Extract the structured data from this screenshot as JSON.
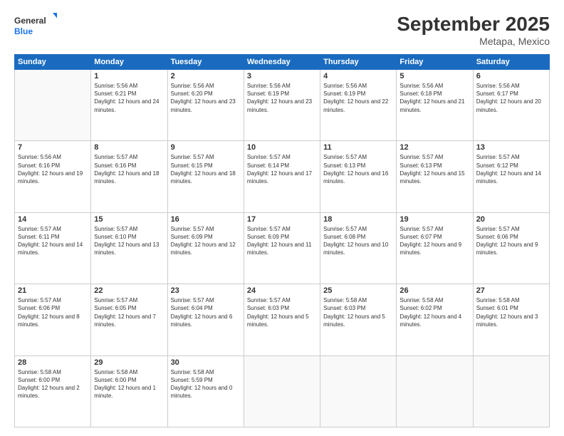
{
  "header": {
    "logo": {
      "general": "General",
      "blue": "Blue"
    },
    "title": "September 2025",
    "subtitle": "Metapa, Mexico"
  },
  "weekdays": [
    "Sunday",
    "Monday",
    "Tuesday",
    "Wednesday",
    "Thursday",
    "Friday",
    "Saturday"
  ],
  "weeks": [
    [
      {
        "day": null
      },
      {
        "day": 1,
        "sunrise": "5:56 AM",
        "sunset": "6:21 PM",
        "daylight": "12 hours and 24 minutes."
      },
      {
        "day": 2,
        "sunrise": "5:56 AM",
        "sunset": "6:20 PM",
        "daylight": "12 hours and 23 minutes."
      },
      {
        "day": 3,
        "sunrise": "5:56 AM",
        "sunset": "6:19 PM",
        "daylight": "12 hours and 23 minutes."
      },
      {
        "day": 4,
        "sunrise": "5:56 AM",
        "sunset": "6:19 PM",
        "daylight": "12 hours and 22 minutes."
      },
      {
        "day": 5,
        "sunrise": "5:56 AM",
        "sunset": "6:18 PM",
        "daylight": "12 hours and 21 minutes."
      },
      {
        "day": 6,
        "sunrise": "5:56 AM",
        "sunset": "6:17 PM",
        "daylight": "12 hours and 20 minutes."
      }
    ],
    [
      {
        "day": 7,
        "sunrise": "5:56 AM",
        "sunset": "6:16 PM",
        "daylight": "12 hours and 19 minutes."
      },
      {
        "day": 8,
        "sunrise": "5:57 AM",
        "sunset": "6:16 PM",
        "daylight": "12 hours and 18 minutes."
      },
      {
        "day": 9,
        "sunrise": "5:57 AM",
        "sunset": "6:15 PM",
        "daylight": "12 hours and 18 minutes."
      },
      {
        "day": 10,
        "sunrise": "5:57 AM",
        "sunset": "6:14 PM",
        "daylight": "12 hours and 17 minutes."
      },
      {
        "day": 11,
        "sunrise": "5:57 AM",
        "sunset": "6:13 PM",
        "daylight": "12 hours and 16 minutes."
      },
      {
        "day": 12,
        "sunrise": "5:57 AM",
        "sunset": "6:13 PM",
        "daylight": "12 hours and 15 minutes."
      },
      {
        "day": 13,
        "sunrise": "5:57 AM",
        "sunset": "6:12 PM",
        "daylight": "12 hours and 14 minutes."
      }
    ],
    [
      {
        "day": 14,
        "sunrise": "5:57 AM",
        "sunset": "6:11 PM",
        "daylight": "12 hours and 14 minutes."
      },
      {
        "day": 15,
        "sunrise": "5:57 AM",
        "sunset": "6:10 PM",
        "daylight": "12 hours and 13 minutes."
      },
      {
        "day": 16,
        "sunrise": "5:57 AM",
        "sunset": "6:09 PM",
        "daylight": "12 hours and 12 minutes."
      },
      {
        "day": 17,
        "sunrise": "5:57 AM",
        "sunset": "6:09 PM",
        "daylight": "12 hours and 11 minutes."
      },
      {
        "day": 18,
        "sunrise": "5:57 AM",
        "sunset": "6:08 PM",
        "daylight": "12 hours and 10 minutes."
      },
      {
        "day": 19,
        "sunrise": "5:57 AM",
        "sunset": "6:07 PM",
        "daylight": "12 hours and 9 minutes."
      },
      {
        "day": 20,
        "sunrise": "5:57 AM",
        "sunset": "6:06 PM",
        "daylight": "12 hours and 9 minutes."
      }
    ],
    [
      {
        "day": 21,
        "sunrise": "5:57 AM",
        "sunset": "6:06 PM",
        "daylight": "12 hours and 8 minutes."
      },
      {
        "day": 22,
        "sunrise": "5:57 AM",
        "sunset": "6:05 PM",
        "daylight": "12 hours and 7 minutes."
      },
      {
        "day": 23,
        "sunrise": "5:57 AM",
        "sunset": "6:04 PM",
        "daylight": "12 hours and 6 minutes."
      },
      {
        "day": 24,
        "sunrise": "5:57 AM",
        "sunset": "6:03 PM",
        "daylight": "12 hours and 5 minutes."
      },
      {
        "day": 25,
        "sunrise": "5:58 AM",
        "sunset": "6:03 PM",
        "daylight": "12 hours and 5 minutes."
      },
      {
        "day": 26,
        "sunrise": "5:58 AM",
        "sunset": "6:02 PM",
        "daylight": "12 hours and 4 minutes."
      },
      {
        "day": 27,
        "sunrise": "5:58 AM",
        "sunset": "6:01 PM",
        "daylight": "12 hours and 3 minutes."
      }
    ],
    [
      {
        "day": 28,
        "sunrise": "5:58 AM",
        "sunset": "6:00 PM",
        "daylight": "12 hours and 2 minutes."
      },
      {
        "day": 29,
        "sunrise": "5:58 AM",
        "sunset": "6:00 PM",
        "daylight": "12 hours and 1 minute."
      },
      {
        "day": 30,
        "sunrise": "5:58 AM",
        "sunset": "5:59 PM",
        "daylight": "12 hours and 0 minutes."
      },
      {
        "day": null
      },
      {
        "day": null
      },
      {
        "day": null
      },
      {
        "day": null
      }
    ]
  ]
}
